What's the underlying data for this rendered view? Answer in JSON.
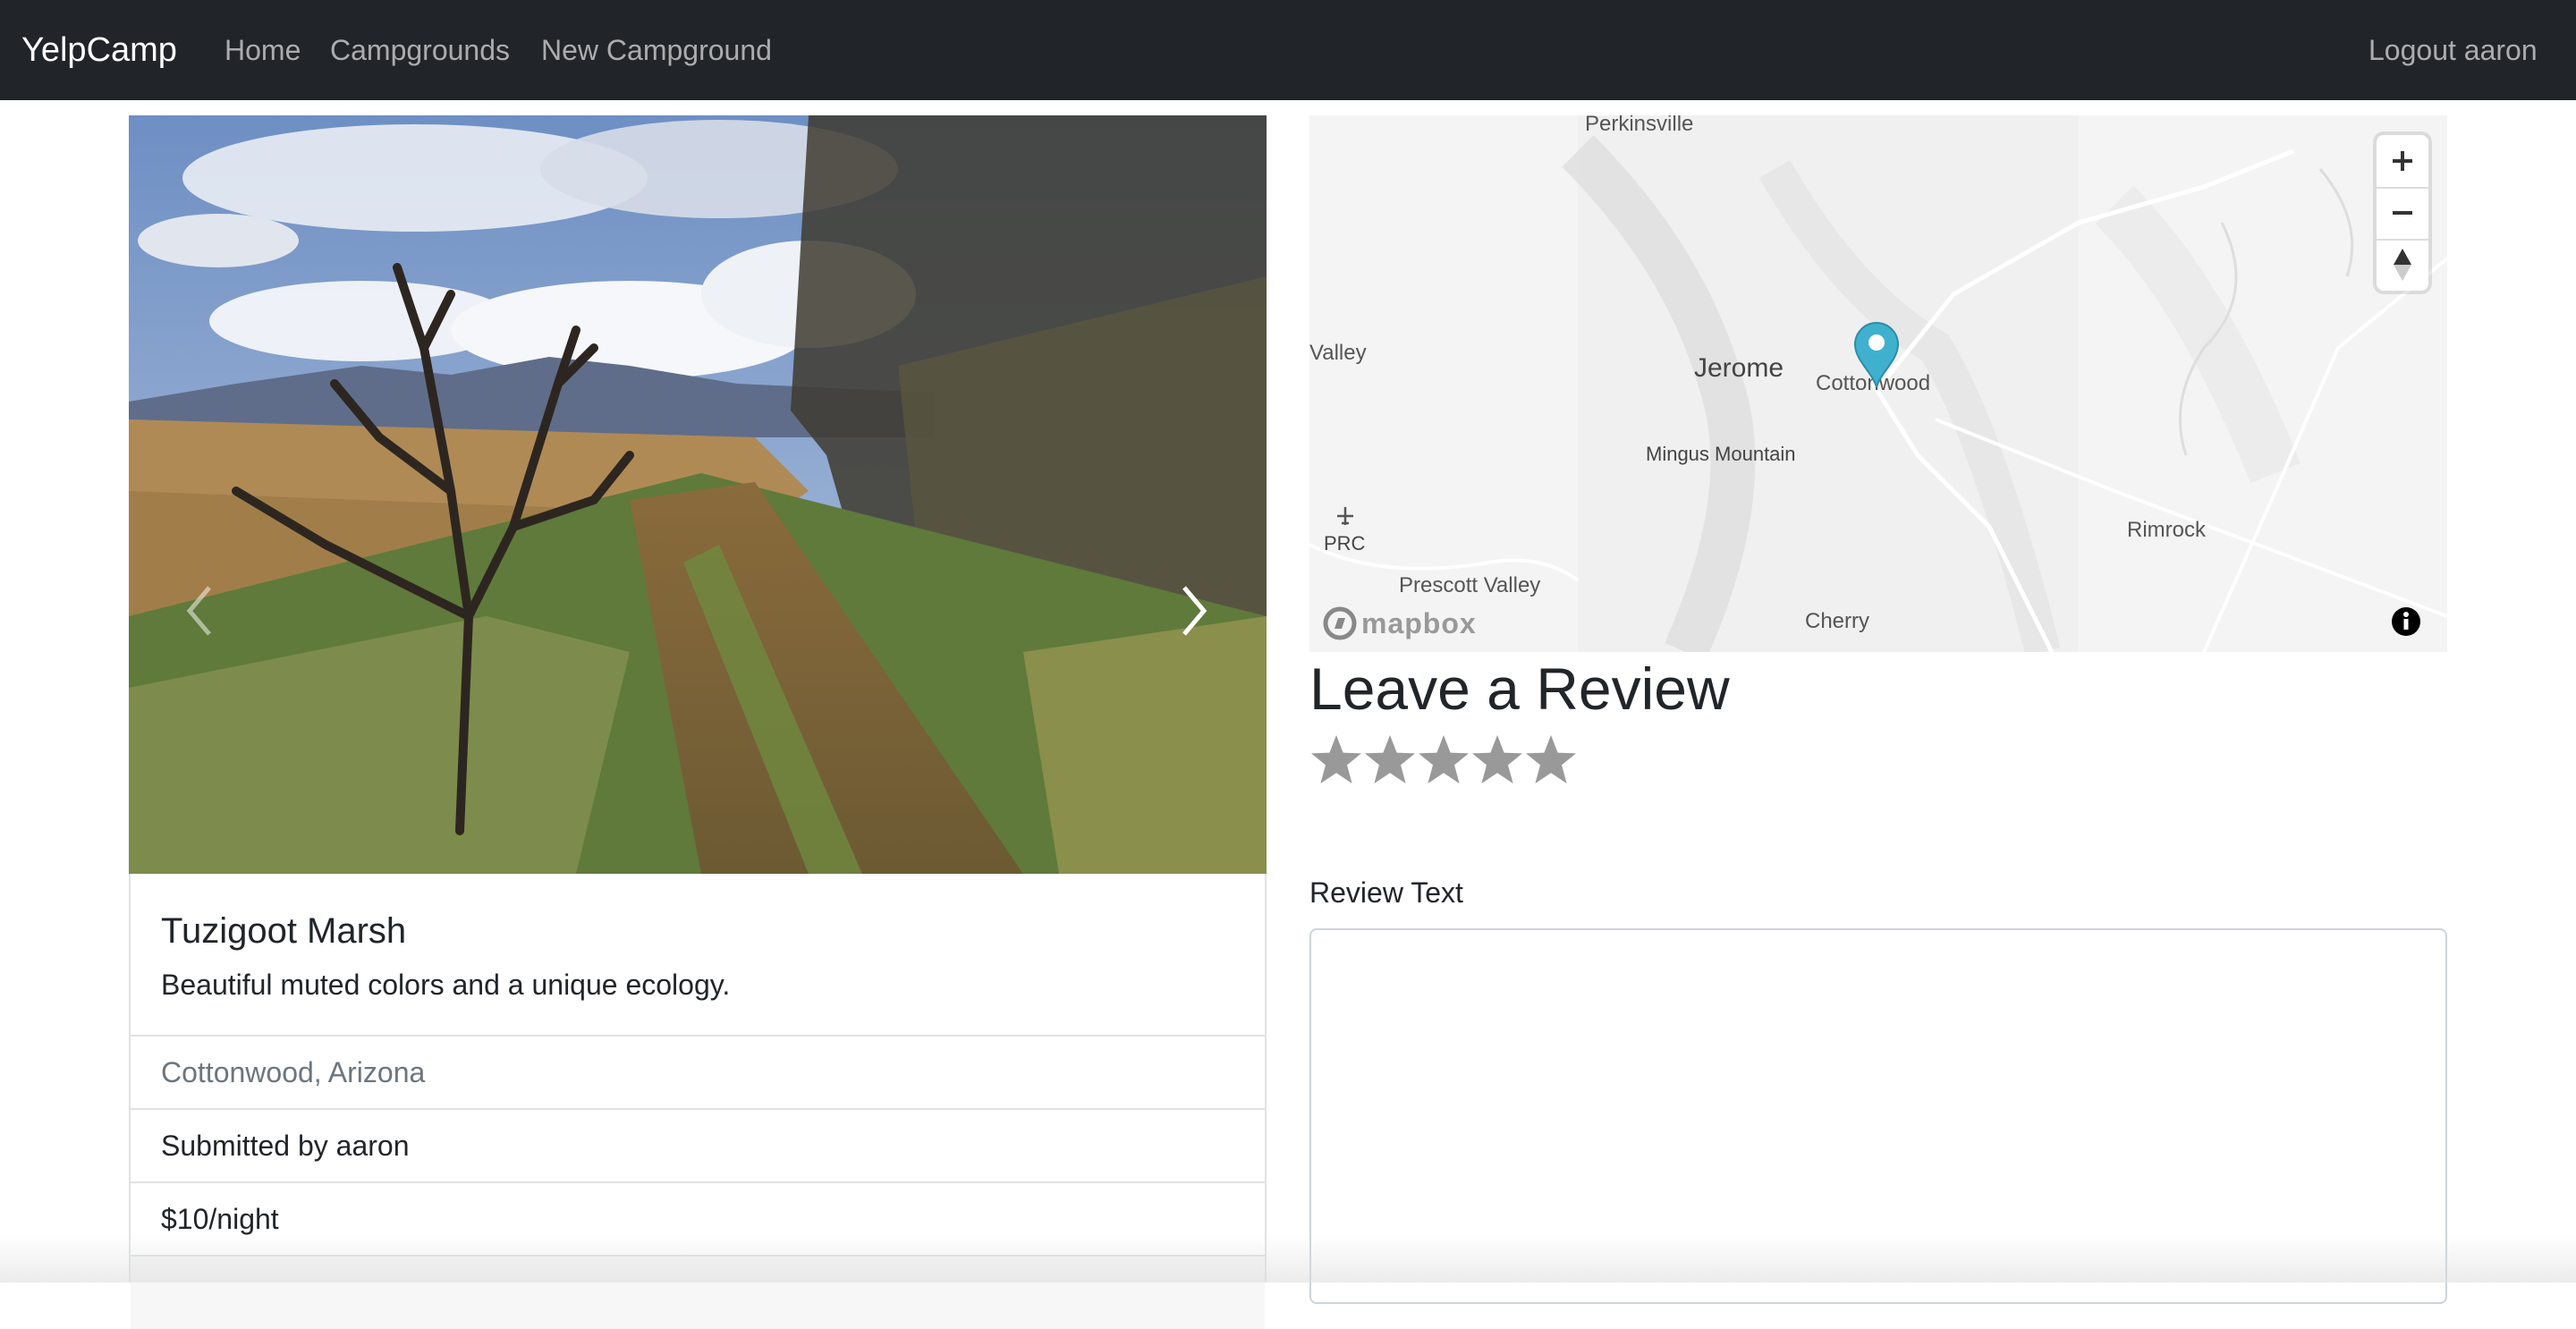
{
  "navbar": {
    "brand": "YelpCamp",
    "links": [
      {
        "label": "Home"
      },
      {
        "label": "Campgrounds"
      },
      {
        "label": "New Campground"
      }
    ],
    "logout_label": "Logout aaron"
  },
  "carousel": {
    "prev_icon": "chevron-left-icon",
    "next_icon": "chevron-right-icon"
  },
  "campground": {
    "title": "Tuzigoot Marsh",
    "description": "Beautiful muted colors and a unique ecology.",
    "location": "Cottonwood, Arizona",
    "submitted_by": "Submitted by aaron",
    "price": "$10/night"
  },
  "map": {
    "labels": {
      "perkinsville": "Perkinsville",
      "valley": "Valley",
      "jerome": "Jerome",
      "cottonwood": "Cottonwood",
      "mingus": "Mingus Mountain",
      "prc": "PRC",
      "prescott_valley": "Prescott Valley",
      "cherry": "Cherry",
      "rimrock": "Rimrock"
    },
    "attribution": "mapbox",
    "marker_color": "#3fb1ce"
  },
  "review": {
    "heading": "Leave a Review",
    "rating_max": 5,
    "text_label": "Review Text",
    "text_value": ""
  },
  "colors": {
    "navbar_bg": "#212529",
    "star_gray": "#999999"
  }
}
